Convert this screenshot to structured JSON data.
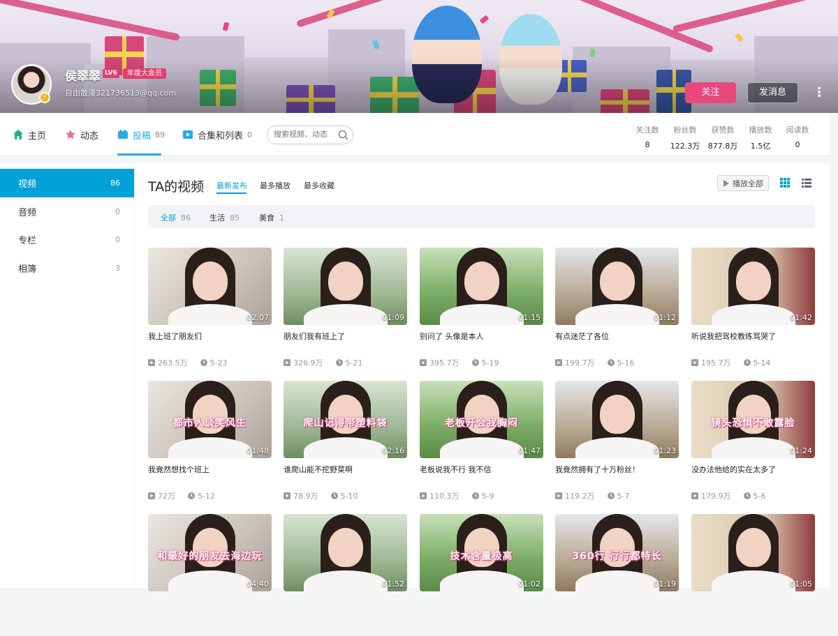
{
  "user": {
    "name": "侯翠翠",
    "level": "LV6",
    "vip_badge": "年度大会员",
    "signature": "自由散漫321736513@qq.com"
  },
  "actions": {
    "follow_label": "关注",
    "message_label": "发消息",
    "more_label": "⋮"
  },
  "nav": {
    "tabs": [
      {
        "label": "主页",
        "count": ""
      },
      {
        "label": "动态",
        "count": ""
      },
      {
        "label": "投稿",
        "count": "89"
      },
      {
        "label": "合集和列表",
        "count": "0"
      }
    ],
    "search_placeholder": "搜索视频、动态"
  },
  "stats": [
    {
      "label": "关注数",
      "value": "8"
    },
    {
      "label": "粉丝数",
      "value": "122.3万"
    },
    {
      "label": "获赞数",
      "value": "877.8万"
    },
    {
      "label": "播放数",
      "value": "1.5亿"
    },
    {
      "label": "阅读数",
      "value": "0"
    }
  ],
  "sidebar": {
    "items": [
      {
        "label": "视频",
        "count": "86"
      },
      {
        "label": "音频",
        "count": "0"
      },
      {
        "label": "专栏",
        "count": "0"
      },
      {
        "label": "相簿",
        "count": "3"
      }
    ]
  },
  "main": {
    "title": "TA的视频",
    "sort_tabs": [
      "最新发布",
      "最多播放",
      "最多收藏"
    ],
    "play_all_label": "播放全部",
    "filters": [
      {
        "label": "全部",
        "count": "86"
      },
      {
        "label": "生活",
        "count": "85"
      },
      {
        "label": "美食",
        "count": "1"
      }
    ]
  },
  "videos": [
    {
      "title": "我上班了朋友们",
      "duration": "02:07",
      "plays": "263.5万",
      "date": "5-23",
      "caption": ""
    },
    {
      "title": "朋友们我有班上了",
      "duration": "01:09",
      "plays": "326.9万",
      "date": "5-21",
      "caption": ""
    },
    {
      "title": "别问了 头像是本人",
      "duration": "01:15",
      "plays": "395.7万",
      "date": "5-19",
      "caption": ""
    },
    {
      "title": "有点迷茫了各位",
      "duration": "01:12",
      "plays": "199.7万",
      "date": "5-16",
      "caption": ""
    },
    {
      "title": "听说我把驾校教练骂哭了",
      "duration": "01:42",
      "plays": "195.7万",
      "date": "5-14",
      "caption": ""
    },
    {
      "title": "我竟然想找个班上",
      "duration": "01:48",
      "plays": "72万",
      "date": "5-12",
      "caption": "都市人谈笑风生"
    },
    {
      "title": "谁爬山能不挖野菜啊",
      "duration": "02:16",
      "plays": "78.9万",
      "date": "5-10",
      "caption": "爬山记得带塑料袋"
    },
    {
      "title": "老板说我不行 我不信",
      "duration": "01:47",
      "plays": "110.3万",
      "date": "5-9",
      "caption": "老板开会我胸闷"
    },
    {
      "title": "我竟然拥有了十万粉丝！",
      "duration": "01:23",
      "plays": "119.2万",
      "date": "5-7",
      "caption": ""
    },
    {
      "title": "没办法他给的实在太多了",
      "duration": "01:24",
      "plays": "179.9万",
      "date": "5-6",
      "caption": "镜头恐惧不敢露脸"
    },
    {
      "title": "",
      "duration": "04:40",
      "plays": "",
      "date": "",
      "caption": "和最好的朋友去海边玩"
    },
    {
      "title": "",
      "duration": "01:52",
      "plays": "",
      "date": "",
      "caption": ""
    },
    {
      "title": "",
      "duration": "01:02",
      "plays": "",
      "date": "",
      "caption": "技术含量极高"
    },
    {
      "title": "",
      "duration": "01:19",
      "plays": "",
      "date": "",
      "caption": "360行 行行都特长"
    },
    {
      "title": "",
      "duration": "01:05",
      "plays": "",
      "date": "",
      "caption": ""
    }
  ],
  "colors": {
    "accent": "#00a1d6",
    "follow": "#e8487c",
    "vip": "#e23d6f"
  }
}
